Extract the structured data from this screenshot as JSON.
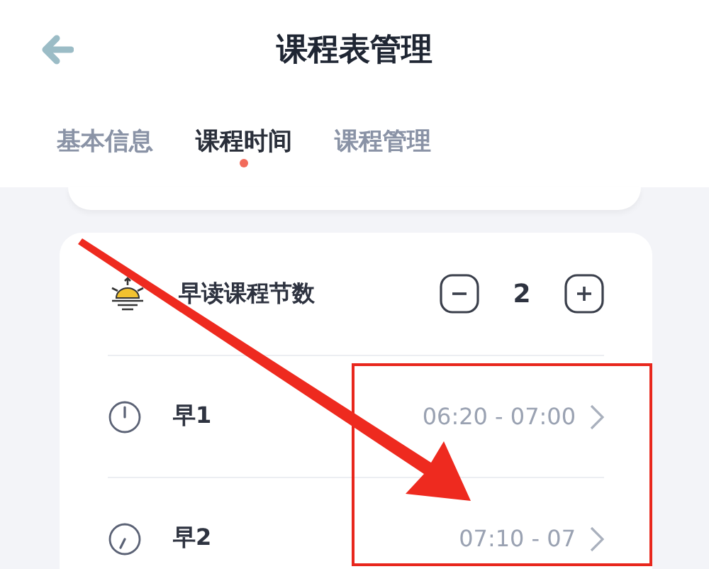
{
  "header": {
    "title": "课程表管理"
  },
  "tabs": [
    {
      "label": "基本信息",
      "selected": false
    },
    {
      "label": "课程时间",
      "selected": true
    },
    {
      "label": "课程管理",
      "selected": false
    }
  ],
  "rows": [
    {
      "kind": "stepper",
      "label": "早读课程节数",
      "value": "2"
    },
    {
      "kind": "time",
      "label": "早1",
      "time": "06:20 - 07:00"
    },
    {
      "kind": "time",
      "label": "早2",
      "time": "07:10 - 07"
    }
  ]
}
